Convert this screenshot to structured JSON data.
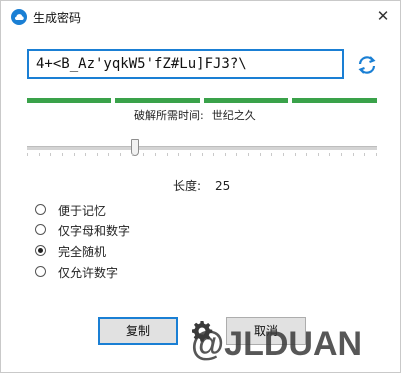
{
  "window": {
    "title": "生成密码",
    "close_label": "✕"
  },
  "password": {
    "value": "4+<B_Az'yqkW5'fZ#Lu]FJ3?\\"
  },
  "strength": {
    "level": 1.0,
    "crack_label": "破解所需时间:",
    "crack_value": "世纪之久"
  },
  "length": {
    "label": "长度:",
    "value": 25,
    "value_text": "25",
    "fraction": 0.309
  },
  "options": [
    {
      "label": "便于记忆",
      "selected": false
    },
    {
      "label": "仅字母和数字",
      "selected": false
    },
    {
      "label": "完全随机",
      "selected": true
    },
    {
      "label": "仅允许数字",
      "selected": false
    }
  ],
  "buttons": {
    "copy_label": "复制",
    "cancel_label": "取消"
  },
  "watermark": {
    "text": "@JLDUAN"
  },
  "colors": {
    "accent": "#1a7fd4",
    "strength_green": "#3aa24a"
  },
  "icons": {
    "app": "cloud-icon",
    "refresh": "refresh-icon",
    "settings": "gear-icon",
    "close": "close-icon"
  }
}
